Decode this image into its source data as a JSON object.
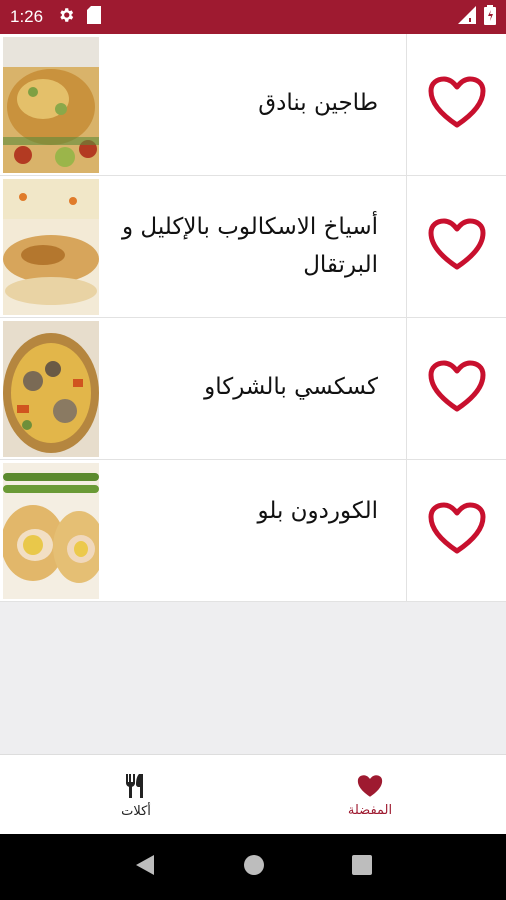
{
  "status_bar": {
    "time": "1:26",
    "icons": [
      "settings-icon",
      "sd-card-icon",
      "signal-icon",
      "battery-icon"
    ],
    "background": "#9e1a30"
  },
  "recipes": [
    {
      "title": "طاجين بنادق",
      "favorite": true
    },
    {
      "title": "أسياخ الاسكالوب بالإكليل و البرتقال",
      "favorite": true
    },
    {
      "title": "كسكسي بالشركاو",
      "favorite": true
    },
    {
      "title": "الكوردون بلو",
      "favorite": true
    }
  ],
  "bottom_nav": {
    "favorites_label": "المفضلة",
    "meals_label": "أكلات",
    "active": "favorites",
    "accent": "#9e1a30"
  },
  "colors": {
    "heart": "#c8102e",
    "accent": "#9e1a30"
  }
}
